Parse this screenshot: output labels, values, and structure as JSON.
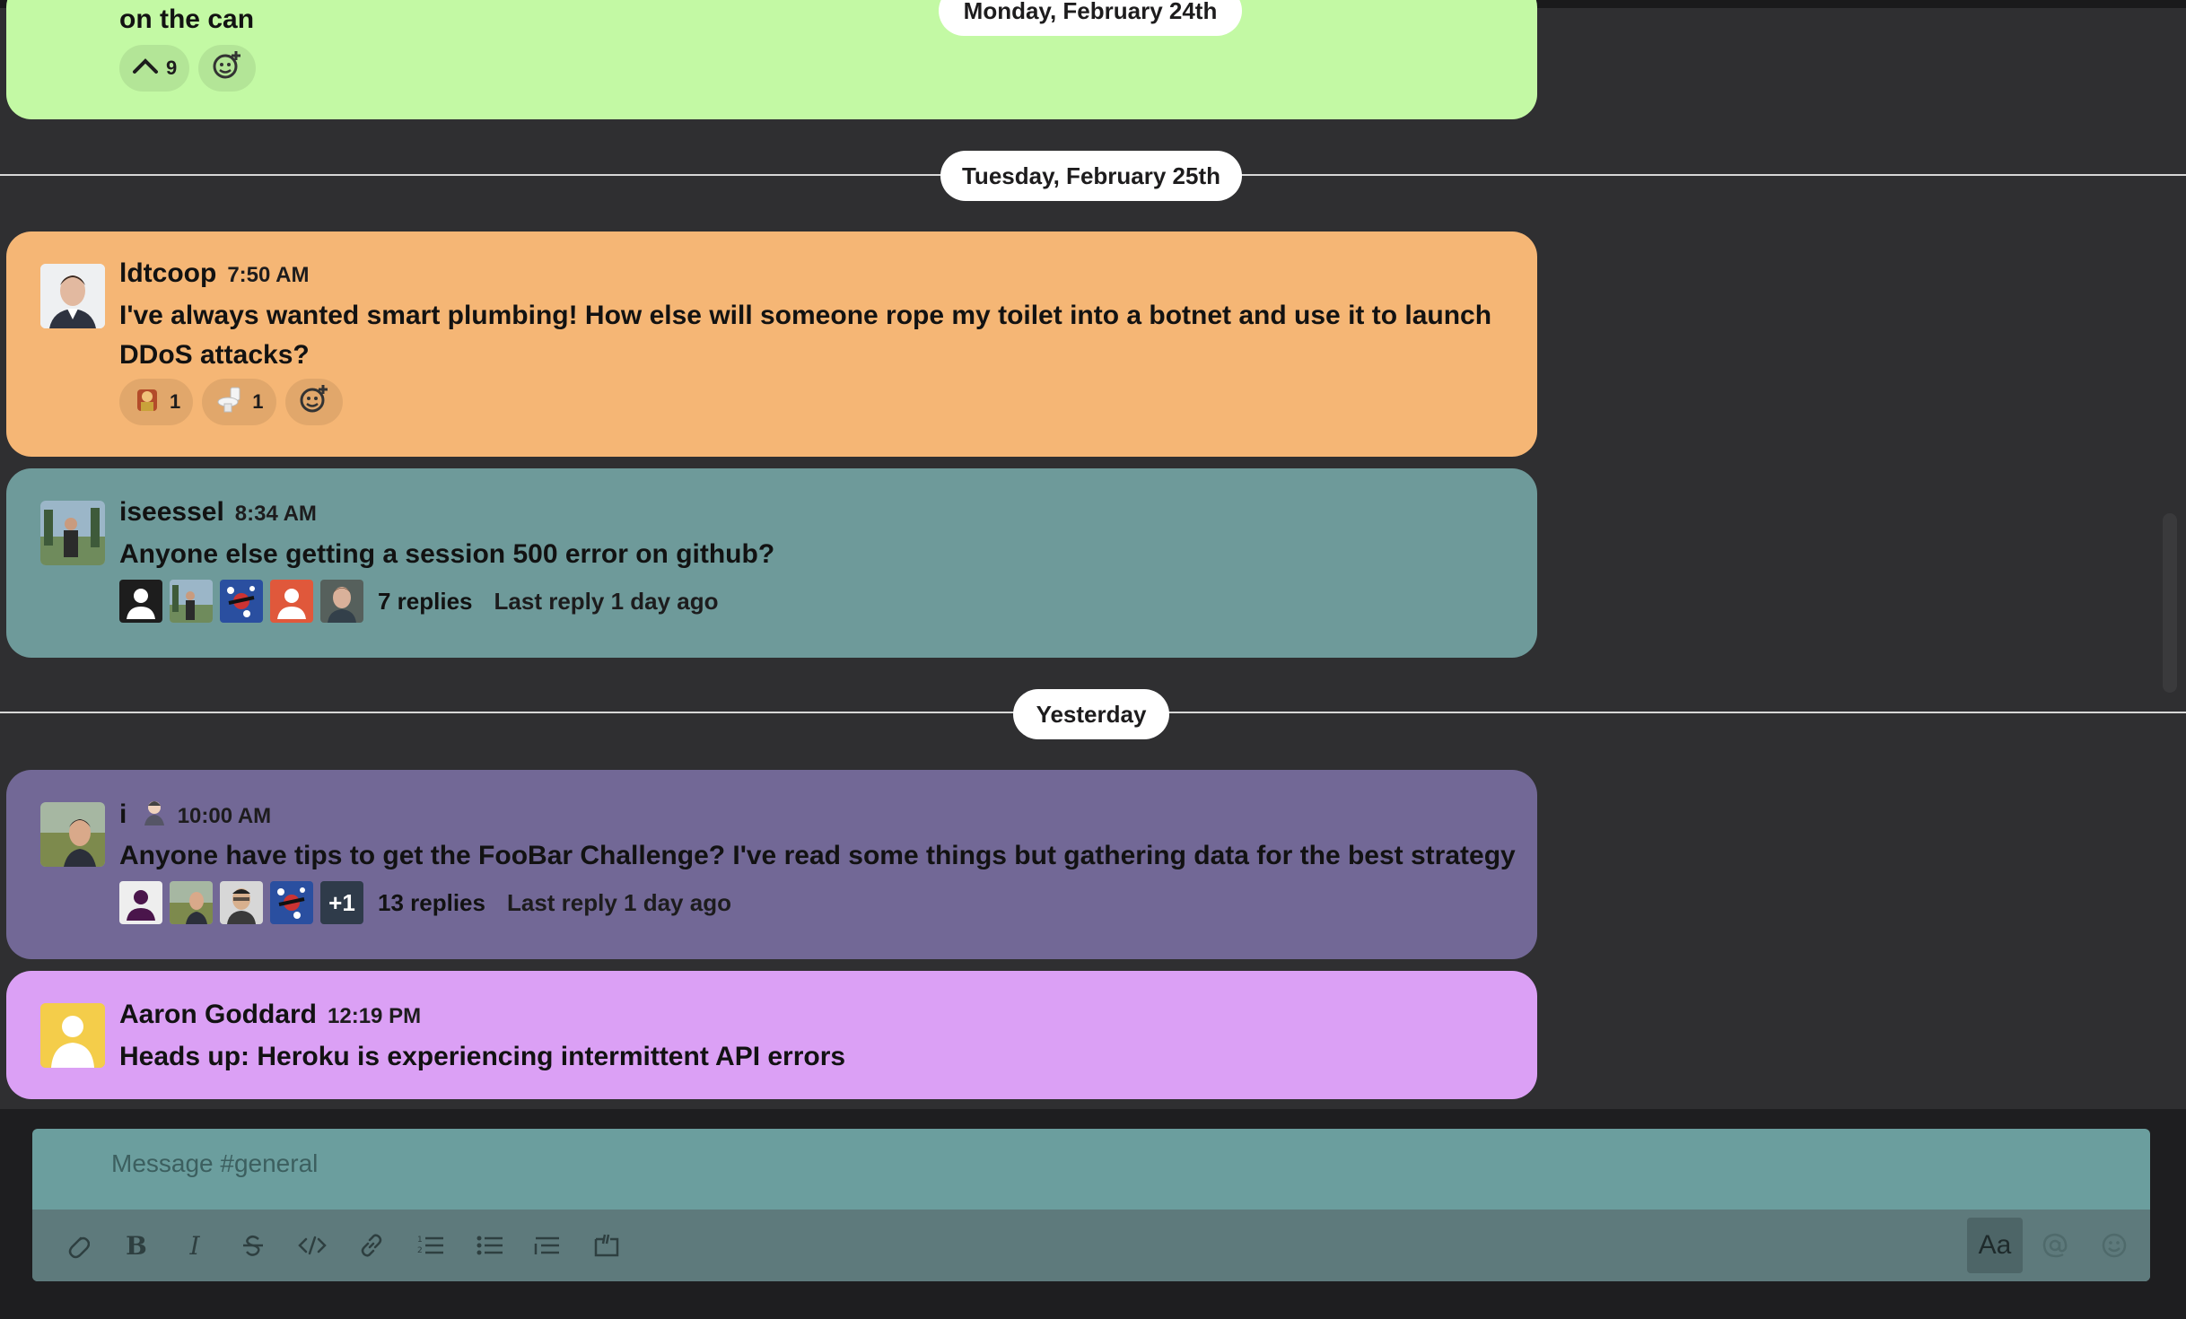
{
  "date_pills": {
    "monday": "Monday, February 24th",
    "tuesday": "Tuesday, February 25th",
    "yesterday": "Yesterday"
  },
  "messages": [
    {
      "text": "on the can",
      "bg": "#c3f9a4",
      "reactions": [
        {
          "icon": "caret-up-icon",
          "count": "9"
        }
      ]
    },
    {
      "author": "ldtcoop",
      "time": "7:50 AM",
      "text": "I've always wanted smart plumbing! How else will someone rope my toilet into a botnet and use it to launch DDoS attacks?",
      "bg": "#f5b675",
      "reactions": [
        {
          "icon": "cartoon-character-emoji",
          "count": "1"
        },
        {
          "icon": "toilet-emoji",
          "count": "1"
        }
      ]
    },
    {
      "author": "iseessel",
      "time": "8:34 AM",
      "text": "Anyone else getting a session 500 error on github?",
      "bg": "#6e9a9a",
      "thread": {
        "replies": "7 replies",
        "last_reply": "Last reply 1 day ago"
      }
    },
    {
      "author": "i",
      "time": "10:00 AM",
      "text": "Anyone have tips to get the FooBar Challenge? I've read some things but gathering data for the best strategy",
      "bg": "#726896",
      "thread": {
        "replies": "13 replies",
        "last_reply": "Last reply 1 day ago",
        "more_badge": "+1"
      }
    },
    {
      "author": "Aaron Goddard",
      "time": "12:19 PM",
      "text": "Heads up: Heroku is experiencing intermittent API errors",
      "bg": "#dba0f5"
    }
  ],
  "composer": {
    "placeholder": "Message #general",
    "format_button": "Aa"
  },
  "toolbar_icons": [
    "attach-icon",
    "bold-icon",
    "italic-icon",
    "strikethrough-icon",
    "code-icon",
    "link-icon",
    "numbered-list-icon",
    "bulleted-list-icon",
    "blockquote-icon",
    "code-block-icon",
    "format-icon",
    "mention-icon",
    "emoji-icon"
  ]
}
